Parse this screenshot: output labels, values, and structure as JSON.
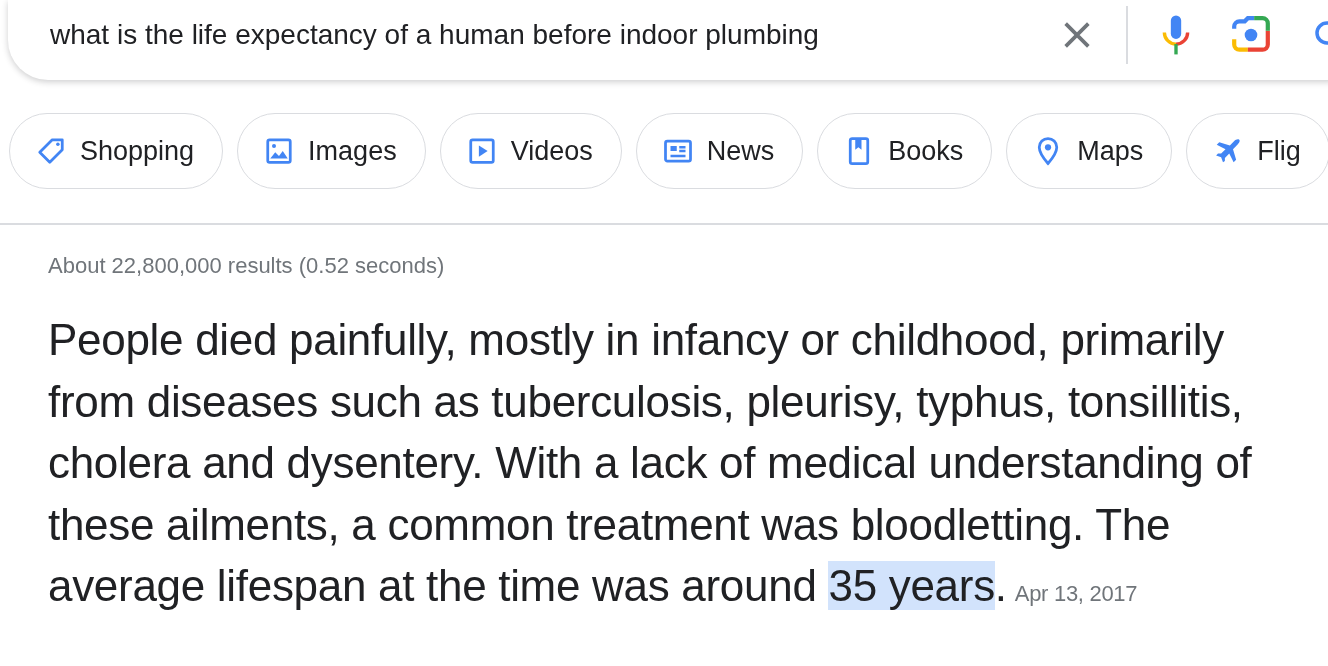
{
  "search": {
    "value": "what is the life expectancy of a human before indoor plumbing"
  },
  "filters": [
    {
      "label": "Shopping",
      "kind": "tag"
    },
    {
      "label": "Images",
      "kind": "image"
    },
    {
      "label": "Videos",
      "kind": "video"
    },
    {
      "label": "News",
      "kind": "news"
    },
    {
      "label": "Books",
      "kind": "book"
    },
    {
      "label": "Maps",
      "kind": "pin"
    },
    {
      "label": "Flig",
      "kind": "plane"
    }
  ],
  "result_stats": "About 22,800,000 results (0.52 seconds)",
  "answer": {
    "text_before": "People died painfully, mostly in infancy or childhood, primarily from diseases such as tuberculosis, pleurisy, typhus, tonsillitis, cholera and dysentery. With a lack of medical understanding of these ailments, a common treatment was bloodletting. The average lifespan at the time was around ",
    "highlighted": "35 years",
    "text_after": ".",
    "date": "Apr 13, 2017"
  }
}
